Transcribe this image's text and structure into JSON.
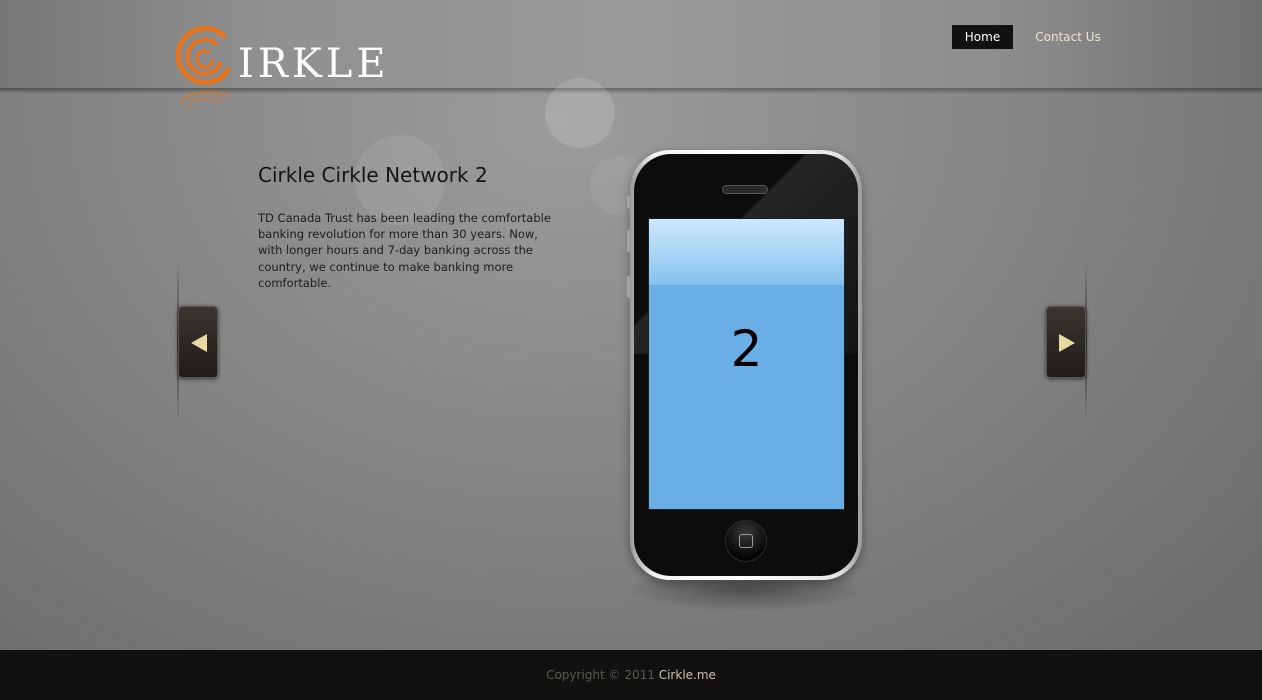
{
  "brand": {
    "logo_text": "IRKLE",
    "logo_mark_icon": "spiral-c-icon",
    "accent_color": "#e8741e"
  },
  "nav": {
    "items": [
      {
        "label": "Home",
        "active": true
      },
      {
        "label": "Contact Us",
        "active": false
      }
    ]
  },
  "slide": {
    "title": "Cirkle Cirkle Network 2",
    "body": "TD Canada Trust has been leading the comfortable banking revolution for more than 30 years. Now, with longer hours and 7-day banking across the country, we continue to make banking more comfortable.",
    "screen_number": "2",
    "screen_color": "#6aaee6",
    "prev_icon": "triangle-left-icon",
    "next_icon": "triangle-right-icon",
    "arrow_color": "#e9dba0"
  },
  "footer": {
    "copyright": "Copyright © 2011",
    "link": "Cirkle.me"
  }
}
